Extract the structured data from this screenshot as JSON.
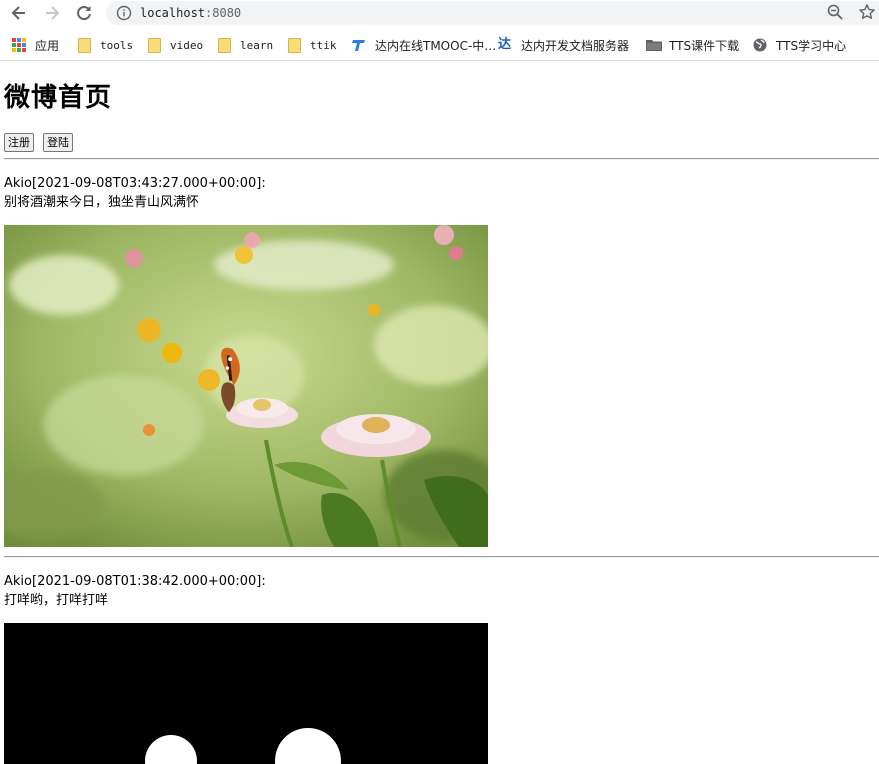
{
  "browser": {
    "url_host": "localhost",
    "url_port": ":8080",
    "bookmarks": [
      {
        "label": "应用",
        "icon": "apps-grid-icon"
      },
      {
        "label": "tools",
        "icon": "folder-icon"
      },
      {
        "label": "video",
        "icon": "folder-icon"
      },
      {
        "label": "learn",
        "icon": "folder-icon"
      },
      {
        "label": "ttik",
        "icon": "folder-icon"
      },
      {
        "label": "达内在线TMOOC-中…",
        "icon": "tmooc-icon"
      },
      {
        "label": "达内开发文档服务器",
        "icon": "tarena-icon"
      },
      {
        "label": "TTS课件下载",
        "icon": "folder-dark-icon"
      },
      {
        "label": "TTS学习中心",
        "icon": "globe-icon"
      }
    ]
  },
  "page": {
    "title": "微博首页",
    "register_label": "注册",
    "login_label": "登陆"
  },
  "posts": [
    {
      "author": "Akio",
      "time": "[2021-09-08T03:43:27.000+00:00]:",
      "content": "别将酒潮来今日，独坐青山风满怀",
      "image": "flower-butterfly-photo"
    },
    {
      "author": "Akio",
      "time": "[2021-09-08T01:38:42.000+00:00]:",
      "content": "打咩哟，打咩打咩",
      "image": "black-image-with-white-circles"
    }
  ],
  "colors": {
    "urlbar_bg": "#f1f3f4",
    "folder_yellow": "#f8dc7a",
    "hr_gray": "#9a9a9a"
  }
}
